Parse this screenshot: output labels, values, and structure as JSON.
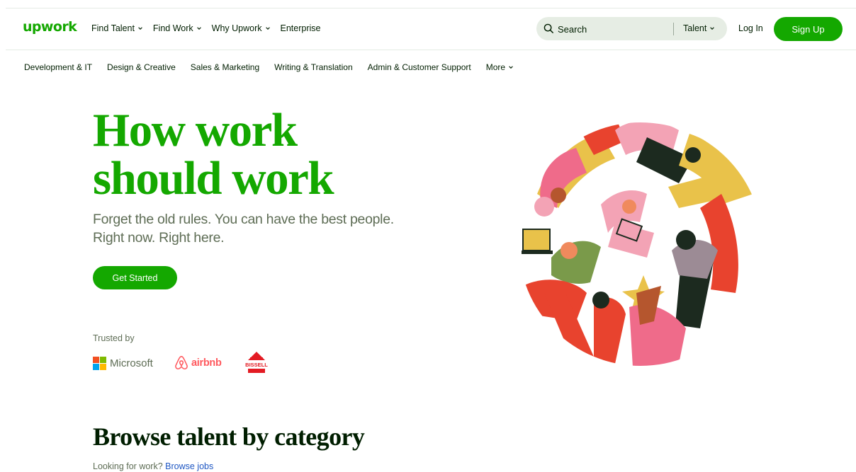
{
  "header": {
    "logo": "upwork",
    "nav": [
      "Find Talent",
      "Find Work",
      "Why Upwork",
      "Enterprise"
    ],
    "search": {
      "placeholder": "Search",
      "scope": "Talent"
    },
    "login": "Log In",
    "signup": "Sign Up"
  },
  "categories": [
    "Development & IT",
    "Design & Creative",
    "Sales & Marketing",
    "Writing & Translation",
    "Admin & Customer Support",
    "More"
  ],
  "hero": {
    "title_line1": "How work",
    "title_line2": "should work",
    "subtitle_line1": "Forget the old rules. You can have the best people.",
    "subtitle_line2": "Right now. Right here.",
    "cta": "Get Started"
  },
  "trusted": {
    "label": "Trusted by",
    "microsoft": "Microsoft",
    "airbnb": "airbnb",
    "bissell": "BISSELL"
  },
  "browse": {
    "title": "Browse talent by category",
    "prompt": "Looking for work?",
    "link": "Browse jobs"
  },
  "colors": {
    "brand_green": "#14a800",
    "text_dark": "#001e00",
    "text_muted": "#5e6d55",
    "link_blue": "#1f57c3",
    "airbnb_red": "#ff5a5f",
    "bissell_red": "#e31b23"
  }
}
